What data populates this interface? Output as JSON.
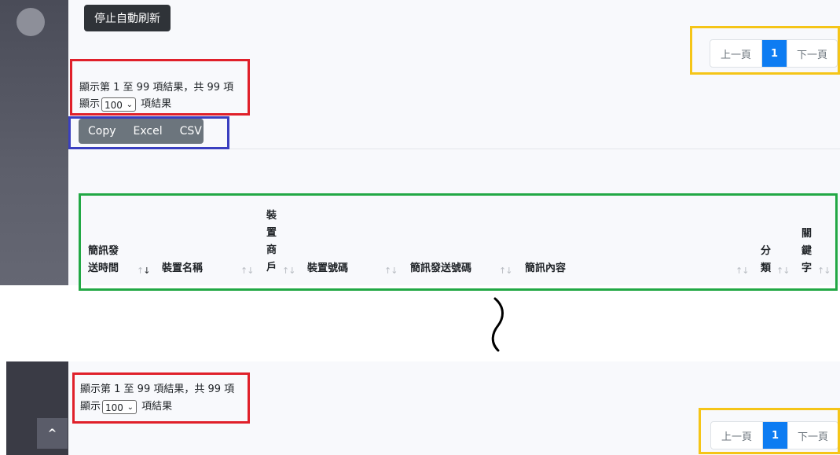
{
  "top": {
    "stop_refresh_label": "停止自動刷新",
    "info": {
      "showing": "顯示第 1 至 99 項結果，共 99 項",
      "show_prefix": "顯示",
      "page_length": "100",
      "show_suffix": "項結果"
    },
    "export_buttons": [
      "Copy",
      "Excel",
      "CSV"
    ],
    "pagination": {
      "prev": "上一頁",
      "current": "1",
      "next": "下一頁"
    },
    "table_headers": [
      {
        "label": "簡訊發送時間",
        "sorted": "desc"
      },
      {
        "label": "裝置名稱"
      },
      {
        "label": "裝置商戶"
      },
      {
        "label": "裝置號碼"
      },
      {
        "label": "簡訊發送號碼"
      },
      {
        "label": "簡訊內容"
      },
      {
        "label": "分類"
      },
      {
        "label": "關鍵字"
      }
    ]
  },
  "bottom": {
    "info": {
      "showing": "顯示第 1 至 99 項結果，共 99 項",
      "show_prefix": "顯示",
      "page_length": "100",
      "show_suffix": "項結果"
    },
    "pagination": {
      "prev": "上一頁",
      "current": "1",
      "next": "下一頁"
    },
    "scroll_top_symbol": "^"
  },
  "annotation_colors": {
    "info": "#e0202a",
    "pagination": "#f5c518",
    "export": "#3a3fc0",
    "table_header": "#22a845"
  }
}
